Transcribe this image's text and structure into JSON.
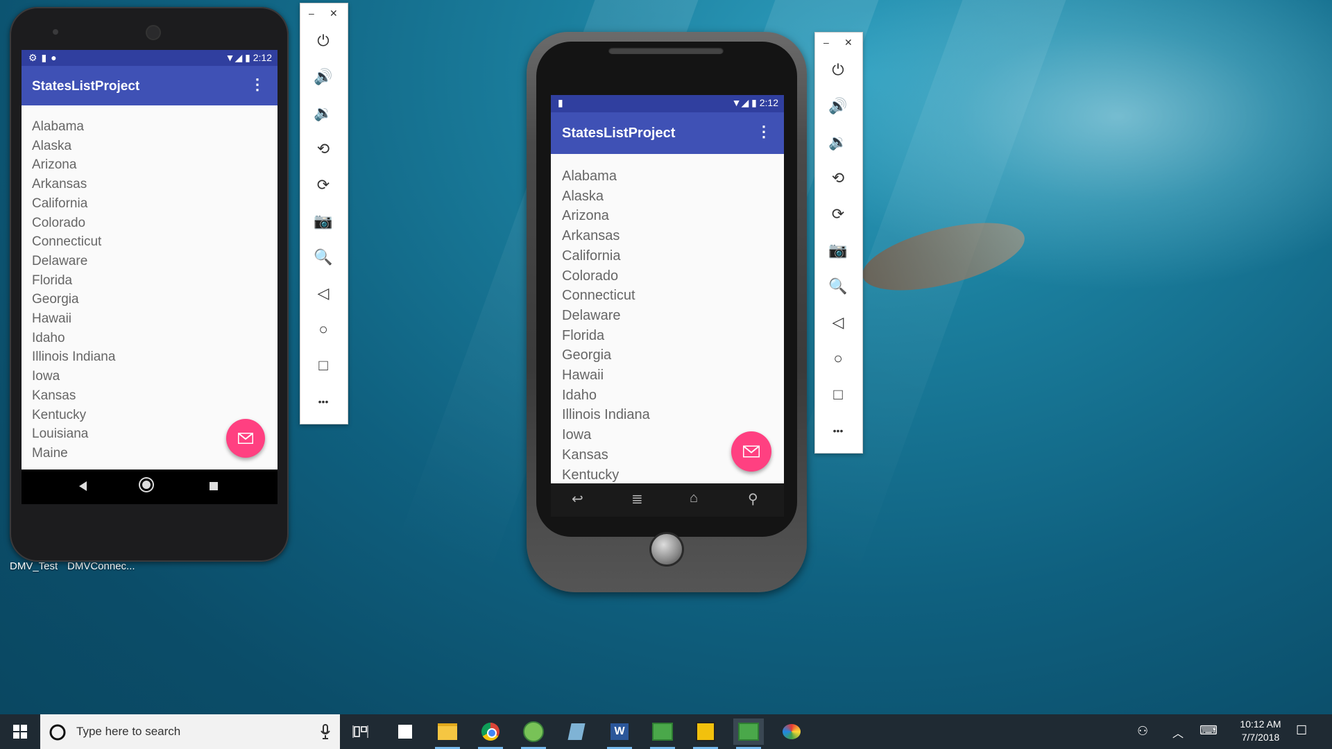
{
  "desktop": {
    "icons": [
      {
        "label": "DMV_Test"
      },
      {
        "label": "DMVConnec..."
      }
    ]
  },
  "emulator_left": {
    "status_time": "2:12",
    "app_title": "StatesListProject",
    "states": [
      "Alabama",
      "Alaska",
      "Arizona",
      "Arkansas",
      "California",
      "Colorado",
      "Connecticut",
      "Delaware",
      "Florida",
      "Georgia",
      "Hawaii",
      "Idaho",
      "Illinois Indiana",
      "Iowa",
      "Kansas",
      "Kentucky",
      "Louisiana",
      "Maine"
    ],
    "panel": {
      "minimize": "–",
      "close": "✕"
    }
  },
  "emulator_right": {
    "status_time": "2:12",
    "app_title": "StatesListProject",
    "states": [
      "Alabama",
      "Alaska",
      "Arizona",
      "Arkansas",
      "California",
      "Colorado",
      "Connecticut",
      "Delaware",
      "Florida",
      "Georgia",
      "Hawaii",
      "Idaho",
      "Illinois Indiana",
      "Iowa",
      "Kansas",
      "Kentucky"
    ],
    "panel": {
      "minimize": "–",
      "close": "✕"
    }
  },
  "panel_buttons": [
    "power-icon",
    "volume-up-icon",
    "volume-down-icon",
    "rotate-left-icon",
    "rotate-right-icon",
    "camera-icon",
    "zoom-icon",
    "back-icon",
    "home-icon",
    "overview-icon",
    "more-icon"
  ],
  "taskbar": {
    "search_placeholder": "Type here to search",
    "clock_time": "10:12 AM",
    "clock_date": "7/7/2018",
    "apps": [
      "task-view-icon",
      "sticky-notes-icon",
      "file-explorer-icon",
      "chrome-icon",
      "android-studio-icon",
      "notepad-icon",
      "word-icon",
      "app-green-icon",
      "app-puzzle-icon",
      "app-green-active-icon",
      "paint-icon"
    ]
  },
  "colors": {
    "primary": "#3f51b5",
    "primary_dark": "#303f9f",
    "accent": "#ff4081",
    "taskbar": "#1f2a33"
  }
}
